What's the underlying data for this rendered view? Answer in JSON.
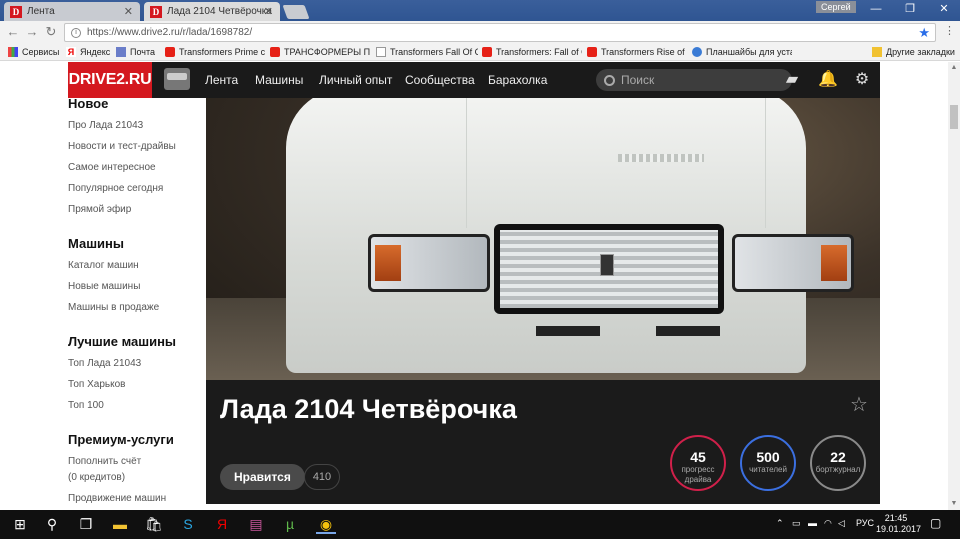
{
  "browser": {
    "tabs": [
      {
        "label": "Лента",
        "active": false
      },
      {
        "label": "Лада 2104 Четвёрочка",
        "active": true
      }
    ],
    "tab_favicon": "D",
    "user": "Сергей",
    "window_buttons": {
      "minimize": "—",
      "maximize": "❐",
      "close": "✕"
    },
    "url": "https://www.drive2.ru/r/lada/1698782/",
    "bookmarks": [
      {
        "label": "Сервисы",
        "icon": "apps-icon"
      },
      {
        "label": "Яндекс",
        "icon": "yandex-icon"
      },
      {
        "label": "Почта",
        "icon": "mail-icon"
      },
      {
        "label": "Transformers Prime с",
        "icon": "youtube-icon"
      },
      {
        "label": "ТРАНСФОРМЕРЫ ПР",
        "icon": "youtube-icon"
      },
      {
        "label": "Transformers Fall Of C",
        "icon": "page-icon"
      },
      {
        "label": "Transformers: Fall of C",
        "icon": "youtube-icon"
      },
      {
        "label": "Transformers Rise of",
        "icon": "youtube-icon"
      },
      {
        "label": "Планшайбы для уста",
        "icon": "extension-icon"
      }
    ],
    "other_bookmarks": "Другие закладки"
  },
  "site": {
    "logo": "DRIVE2.RU",
    "nav": [
      "Лента",
      "Машины",
      "Личный опыт",
      "Сообщества",
      "Барахолка"
    ],
    "search_placeholder": "Поиск"
  },
  "sidebar": {
    "sections": [
      {
        "title": "Новое",
        "links": [
          "Про Лада 21043",
          "Новости и тест-драйвы",
          "Самое интересное",
          "Популярное сегодня",
          "Прямой эфир"
        ]
      },
      {
        "title": "Машины",
        "links": [
          "Каталог машин",
          "Новые машины",
          "Машины в продаже"
        ]
      },
      {
        "title": "Лучшие машины",
        "links": [
          "Топ Лада 21043",
          "Топ Харьков",
          "Топ 100"
        ]
      },
      {
        "title": "Премиум-услуги",
        "links": [
          "Пополнить счёт",
          "(0 кредитов)",
          "Продвижение машин"
        ]
      }
    ]
  },
  "car": {
    "title": "Лада 2104 Четвёрочка",
    "like_label": "Нравится",
    "like_count": "410",
    "stats": [
      {
        "value": "45",
        "label1": "прогресс",
        "label2": "драйва",
        "color": "#d0204a"
      },
      {
        "value": "500",
        "label1": "читателей",
        "label2": "",
        "color": "#3b6fe0"
      },
      {
        "value": "22",
        "label1": "бортжурнал",
        "label2": "",
        "color": "#8a8a8a"
      }
    ]
  },
  "taskbar": {
    "language": "РУС",
    "time": "21:45",
    "date": "19.01.2017"
  }
}
